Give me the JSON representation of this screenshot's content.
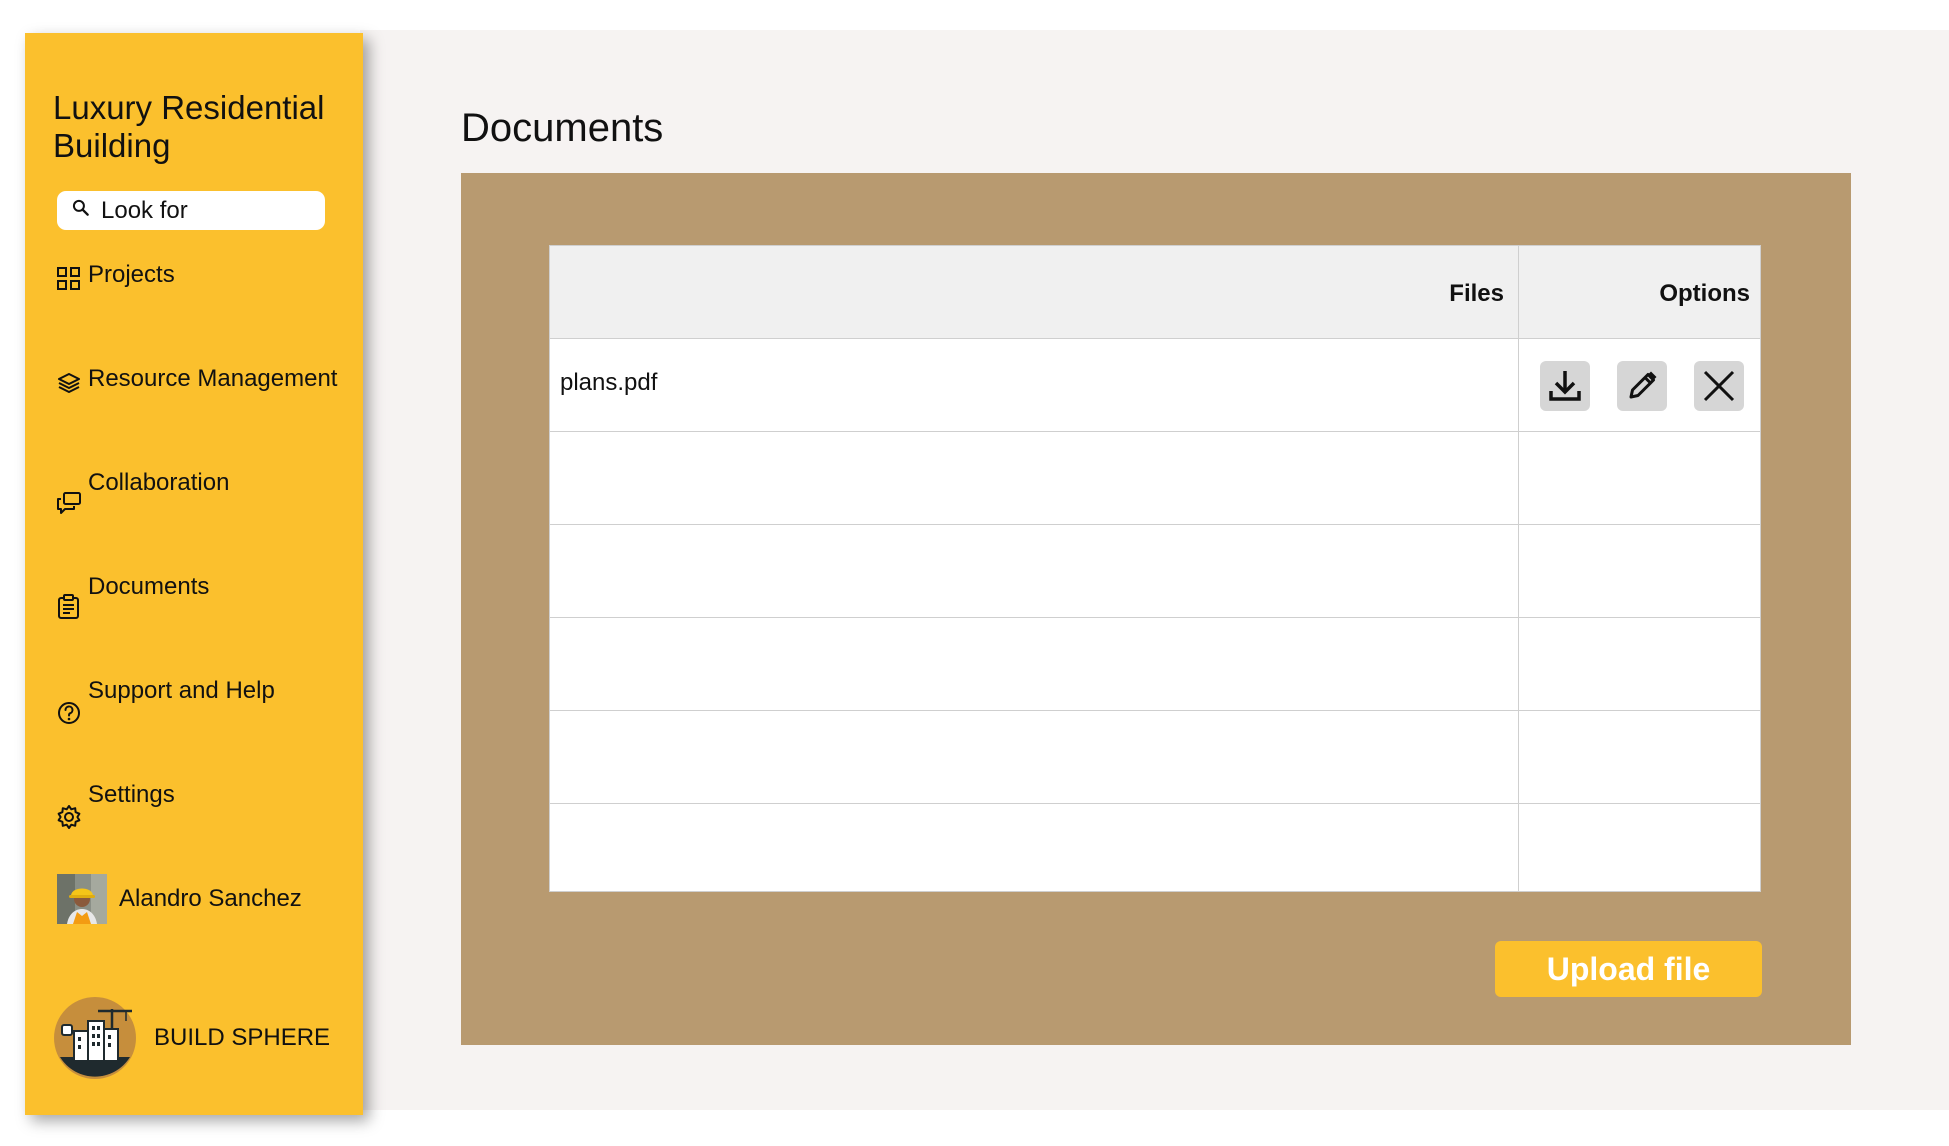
{
  "sidebar": {
    "project_title": "Luxury Residential Building",
    "search": {
      "value": "Look for"
    },
    "items": [
      {
        "label": "Projects",
        "icon": "grid-icon"
      },
      {
        "label": "Resource Management",
        "icon": "layers-icon"
      },
      {
        "label": "Collaboration",
        "icon": "chat-icon"
      },
      {
        "label": "Documents",
        "icon": "clipboard-icon"
      },
      {
        "label": "Support and Help",
        "icon": "help-icon"
      },
      {
        "label": "Settings",
        "icon": "gear-icon"
      }
    ],
    "user": {
      "name": "Alandro Sanchez"
    },
    "brand": {
      "name": "BUILD SPHERE"
    }
  },
  "main": {
    "title": "Documents",
    "table": {
      "columns": [
        "Files",
        "Options"
      ],
      "rows": [
        {
          "file": "plans.pdf",
          "actions": [
            "download-icon",
            "edit-icon",
            "close-icon"
          ]
        },
        {
          "file": ""
        },
        {
          "file": ""
        },
        {
          "file": ""
        },
        {
          "file": ""
        },
        {
          "file": ""
        }
      ]
    },
    "upload_label": "Upload file"
  },
  "colors": {
    "sidebar": "#fbc02d",
    "panel": "#b89a70",
    "background": "#f6f3f2",
    "accent": "#fbc02d"
  }
}
